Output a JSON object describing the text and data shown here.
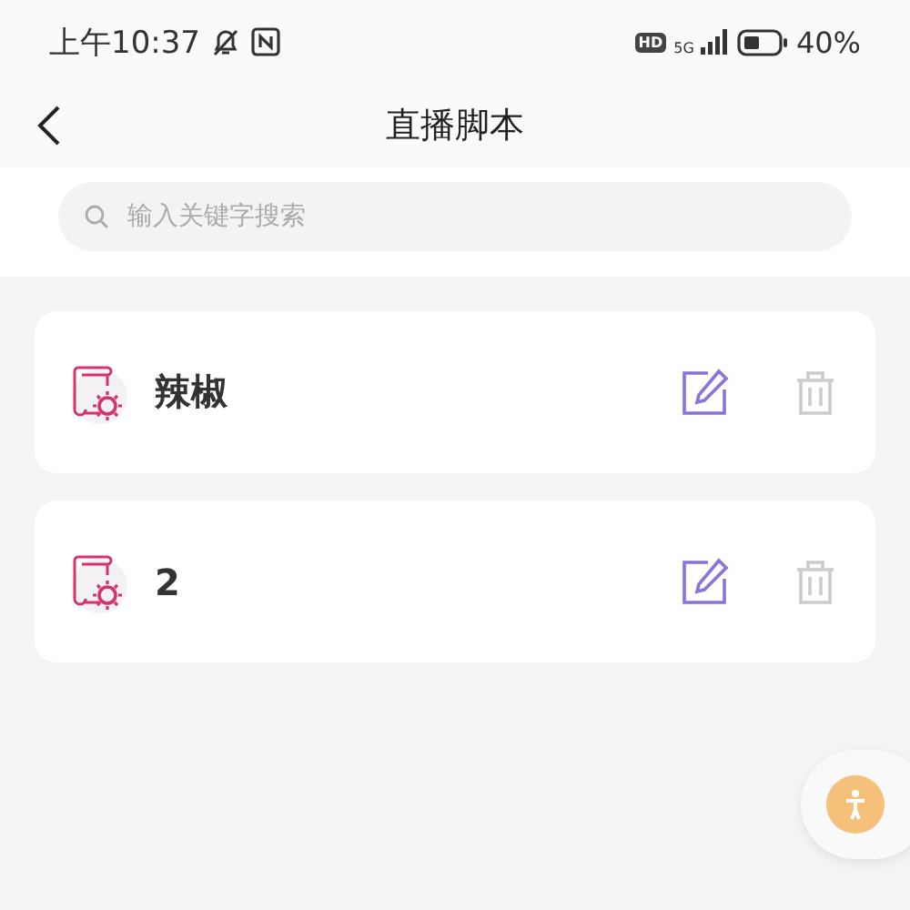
{
  "status_bar": {
    "time": "上午10:37",
    "hd": "HD",
    "network": "5G",
    "battery": "40%"
  },
  "header": {
    "title": "直播脚本"
  },
  "search": {
    "placeholder": "输入关键字搜索"
  },
  "scripts": [
    {
      "name": "辣椒"
    },
    {
      "name": "2"
    }
  ]
}
